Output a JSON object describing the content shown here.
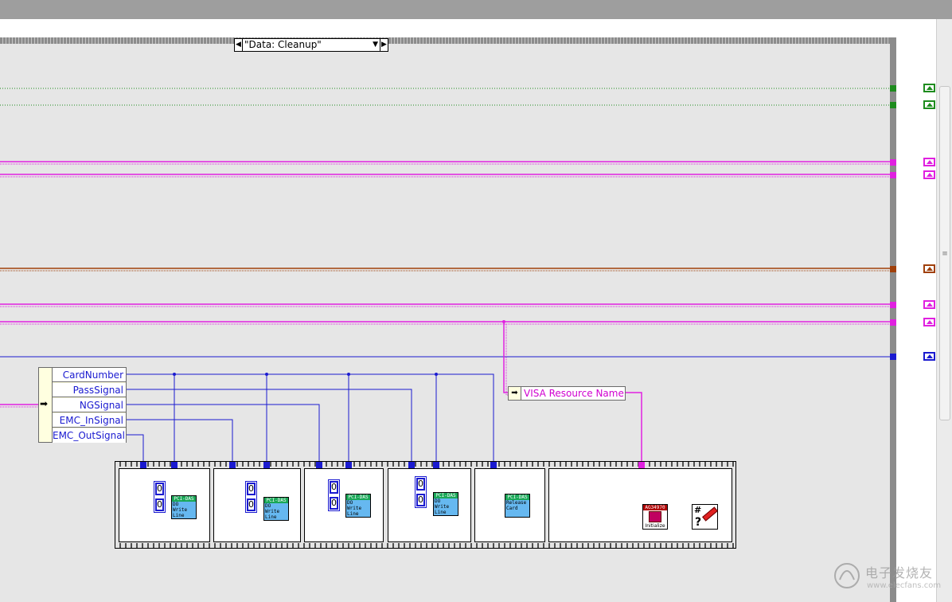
{
  "case_selector": {
    "label": "\"Data: Cleanup\"",
    "decrement_glyph": "◀",
    "increment_glyph": "▶",
    "dropdown_glyph": "▼"
  },
  "unbundle": {
    "arrow_glyph": "➡",
    "elements": [
      "CardNumber",
      "PassSignal",
      "NGSignal",
      "EMC_InSignal",
      "EMC_OutSignal"
    ]
  },
  "visa_property": {
    "arrow_glyph": "➡",
    "name": "VISA Resource Name"
  },
  "frames": {
    "write_line_nodes": [
      {
        "header": "PCI-DAS",
        "line1": "DO",
        "line2": "Write",
        "line3": "Line"
      },
      {
        "header": "PCI-DAS",
        "line1": "DO",
        "line2": "Write",
        "line3": "Line"
      },
      {
        "header": "PCI-DAS",
        "line1": "DO",
        "line2": "Write",
        "line3": "Line"
      },
      {
        "header": "PCI-DAS",
        "line1": "DO",
        "line2": "Write",
        "line3": "Line"
      }
    ],
    "constants": [
      "0",
      "0"
    ],
    "release_node": {
      "header": "PCI-DAS",
      "line1": "Release",
      "line2": "Card"
    },
    "init_node": {
      "header": "AG34970",
      "footer": "Initialize"
    },
    "error_node": {
      "hash": "#",
      "q": "?"
    }
  },
  "scrollbar": {
    "grip": "≡"
  },
  "watermark": {
    "cn": "电子发烧友",
    "url": "www.elecfans.com"
  },
  "colors": {
    "green_wire": "#1e8c1e",
    "pink_wire": "#e020e0",
    "orange_wire": "#a0400a",
    "blue_wire": "#1a1ad0",
    "diagram_bg": "#e6e6e6",
    "frame_border": "#8c8c8c"
  }
}
